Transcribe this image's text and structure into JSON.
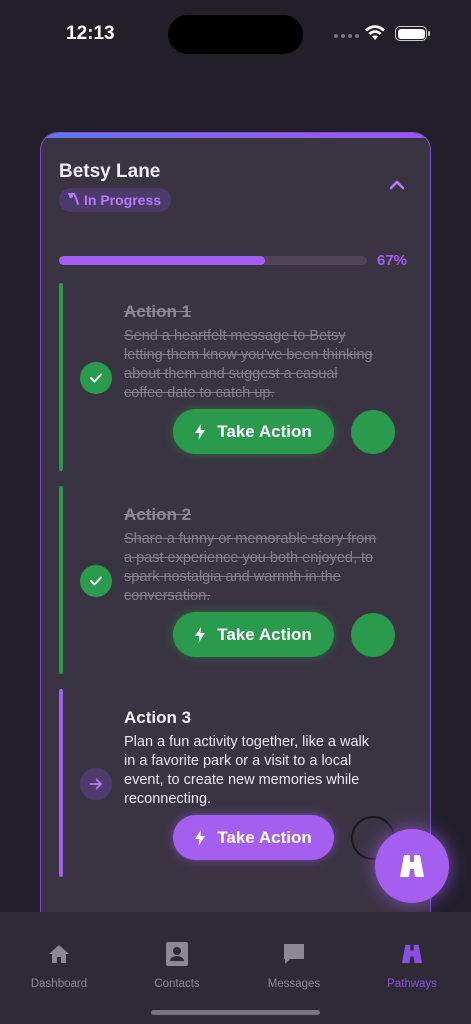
{
  "status_bar": {
    "time": "12:13"
  },
  "card": {
    "name": "Betsy Lane",
    "status": "In Progress",
    "progress": {
      "value": 0.67,
      "label": "67%"
    },
    "actions": [
      {
        "title": "Action 1",
        "description": "Send a heartfelt message to Betsy letting them know you've been thinking about them and suggest a casual coffee date to catch up.",
        "button_label": "Take Action",
        "completed": true
      },
      {
        "title": "Action 2",
        "description": "Share a funny or memorable story from a past experience you both enjoyed, to spark nostalgia and warmth in the conversation.",
        "button_label": "Take Action",
        "completed": true
      },
      {
        "title": "Action 3",
        "description": "Plan a fun activity together, like a walk in a favorite park or a visit to a local event, to create new memories while reconnecting.",
        "button_label": "Take Action",
        "completed": false
      }
    ]
  },
  "tabbar": {
    "tabs": [
      {
        "label": "Dashboard",
        "icon": "home-icon"
      },
      {
        "label": "Contacts",
        "icon": "contacts-icon"
      },
      {
        "label": "Messages",
        "icon": "messages-icon"
      },
      {
        "label": "Pathways",
        "icon": "pathways-icon",
        "selected": true
      }
    ]
  },
  "colors": {
    "accent": "#a45ff0",
    "success": "#2a9a4c",
    "background": "#221f2b",
    "card": "#3a3442"
  }
}
